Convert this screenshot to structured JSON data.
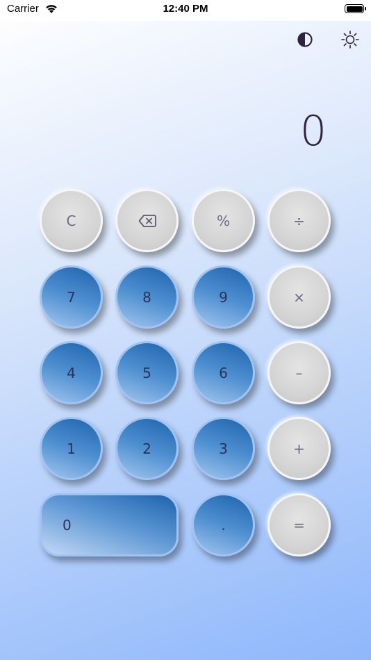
{
  "status_bar": {
    "carrier": "Carrier",
    "time": "12:40 PM"
  },
  "display": {
    "value": "0"
  },
  "icons": {
    "contrast": "contrast-icon",
    "brightness": "brightness-icon",
    "backspace": "backspace-icon",
    "wifi": "wifi-icon",
    "battery": "battery-icon"
  },
  "keys": {
    "clear": "C",
    "percent": "%",
    "divide": "÷",
    "seven": "7",
    "eight": "8",
    "nine": "9",
    "multiply": "×",
    "four": "4",
    "five": "5",
    "six": "6",
    "minus": "–",
    "one": "1",
    "two": "2",
    "three": "3",
    "plus": "+",
    "zero": "0",
    "decimal": ".",
    "equals": "="
  },
  "colors": {
    "function_key": "#d4d4d4",
    "digit_key": "#4d8fd0",
    "display_text": "#2d2340"
  }
}
